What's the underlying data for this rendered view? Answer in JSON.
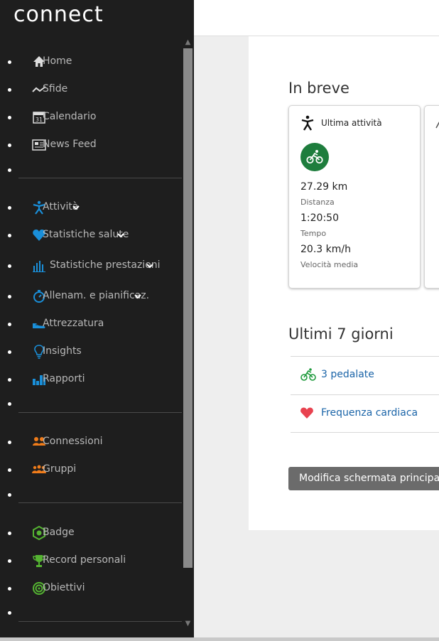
{
  "sidebar": {
    "logo": "connect",
    "groups": [
      [
        {
          "label": "Home",
          "icon": "home-icon"
        },
        {
          "label": "Sfide",
          "icon": "challenge-icon"
        },
        {
          "label": "Calendario",
          "icon": "calendar-icon",
          "icon_text": "31"
        },
        {
          "label": "News Feed",
          "icon": "news-icon"
        }
      ],
      [
        {
          "label": "Attività",
          "icon": "activity-icon",
          "expandable": true
        },
        {
          "label": "Statistiche salute",
          "icon": "heart-icon",
          "expandable": true
        },
        {
          "label": "Statistiche prestazioni",
          "icon": "bar-chart-icon",
          "expandable": true
        },
        {
          "label": "Allenam. e pianificaz.",
          "icon": "stopwatch-icon",
          "expandable": true
        },
        {
          "label": "Attrezzatura",
          "icon": "shoe-icon"
        },
        {
          "label": "Insights",
          "icon": "lightbulb-icon"
        },
        {
          "label": "Rapporti",
          "icon": "report-icon"
        }
      ],
      [
        {
          "label": "Connessioni",
          "icon": "connections-icon"
        },
        {
          "label": "Gruppi",
          "icon": "groups-icon"
        }
      ],
      [
        {
          "label": "Badge",
          "icon": "badge-icon"
        },
        {
          "label": "Record personali",
          "icon": "trophy-icon"
        },
        {
          "label": "Obiettivi",
          "icon": "target-icon"
        }
      ]
    ]
  },
  "main": {
    "overview_title": "In breve",
    "last_activity": {
      "title": "Ultima attività",
      "distance_value": "27.29 km",
      "distance_label": "Distanza",
      "time_value": "1:20:50",
      "time_label": "Tempo",
      "speed_value": "20.3 km/h",
      "speed_label": "Velocità media"
    },
    "last7_title": "Ultimi 7 giorni",
    "last7_items": [
      {
        "label": "3 pedalate",
        "icon": "bike-icon"
      },
      {
        "label": "Frequenza cardiaca",
        "icon": "heart-icon"
      }
    ],
    "edit_button": "Modifica schermata principale"
  },
  "colors": {
    "sidebar_bg": "#1e1e1e",
    "activity_blue": "#1a8fd9",
    "health_blue": "#1a8fd9",
    "social_orange": "#f07c1a",
    "achievement_green": "#55b432",
    "bike_green": "#1e7d3d",
    "link_blue": "#1a64a8",
    "heart_red": "#e8424f"
  }
}
